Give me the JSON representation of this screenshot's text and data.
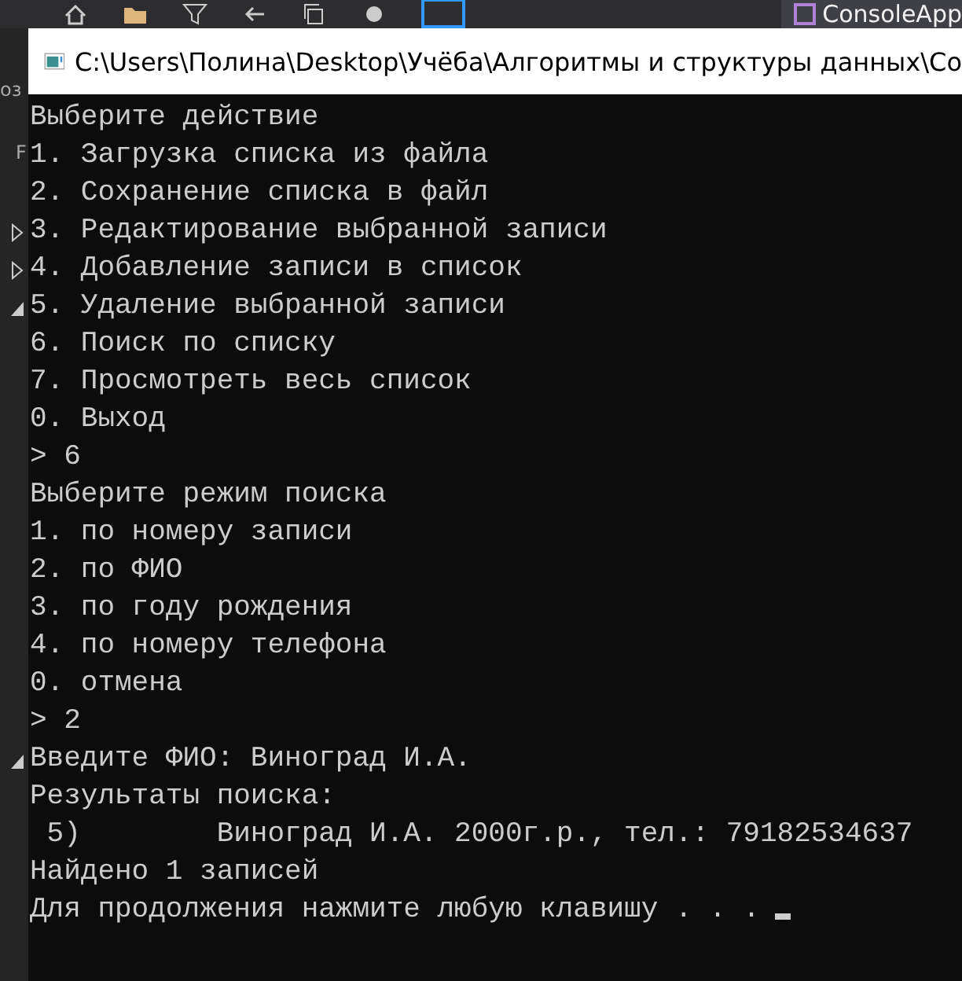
{
  "ide": {
    "tab_title": "ConsoleApp",
    "left_fragments": [
      "оз",
      "F"
    ]
  },
  "console": {
    "title": "C:\\Users\\Полина\\Desktop\\Учёба\\Алгоритмы и структуры данных\\Co",
    "lines": [
      "Выберите действие",
      "1. Загрузка списка из файла",
      "2. Сохранение списка в файл",
      "3. Редактирование выбранной записи",
      "4. Добавление записи в список",
      "5. Удаление выбранной записи",
      "6. Поиск по списку",
      "7. Просмотреть весь список",
      "0. Выход",
      "> 6",
      "Выберите режим поиска",
      "1. по номеру записи",
      "2. по ФИО",
      "3. по году рождения",
      "4. по номеру телефона",
      "0. отмена",
      "> 2",
      "Введите ФИО: Виноград И.А.",
      "Результаты поиска:",
      " 5)        Виноград И.А. 2000г.р., тел.: 79182534637",
      "Найдено 1 записей",
      "Для продолжения нажмите любую клавишу . . ."
    ]
  }
}
